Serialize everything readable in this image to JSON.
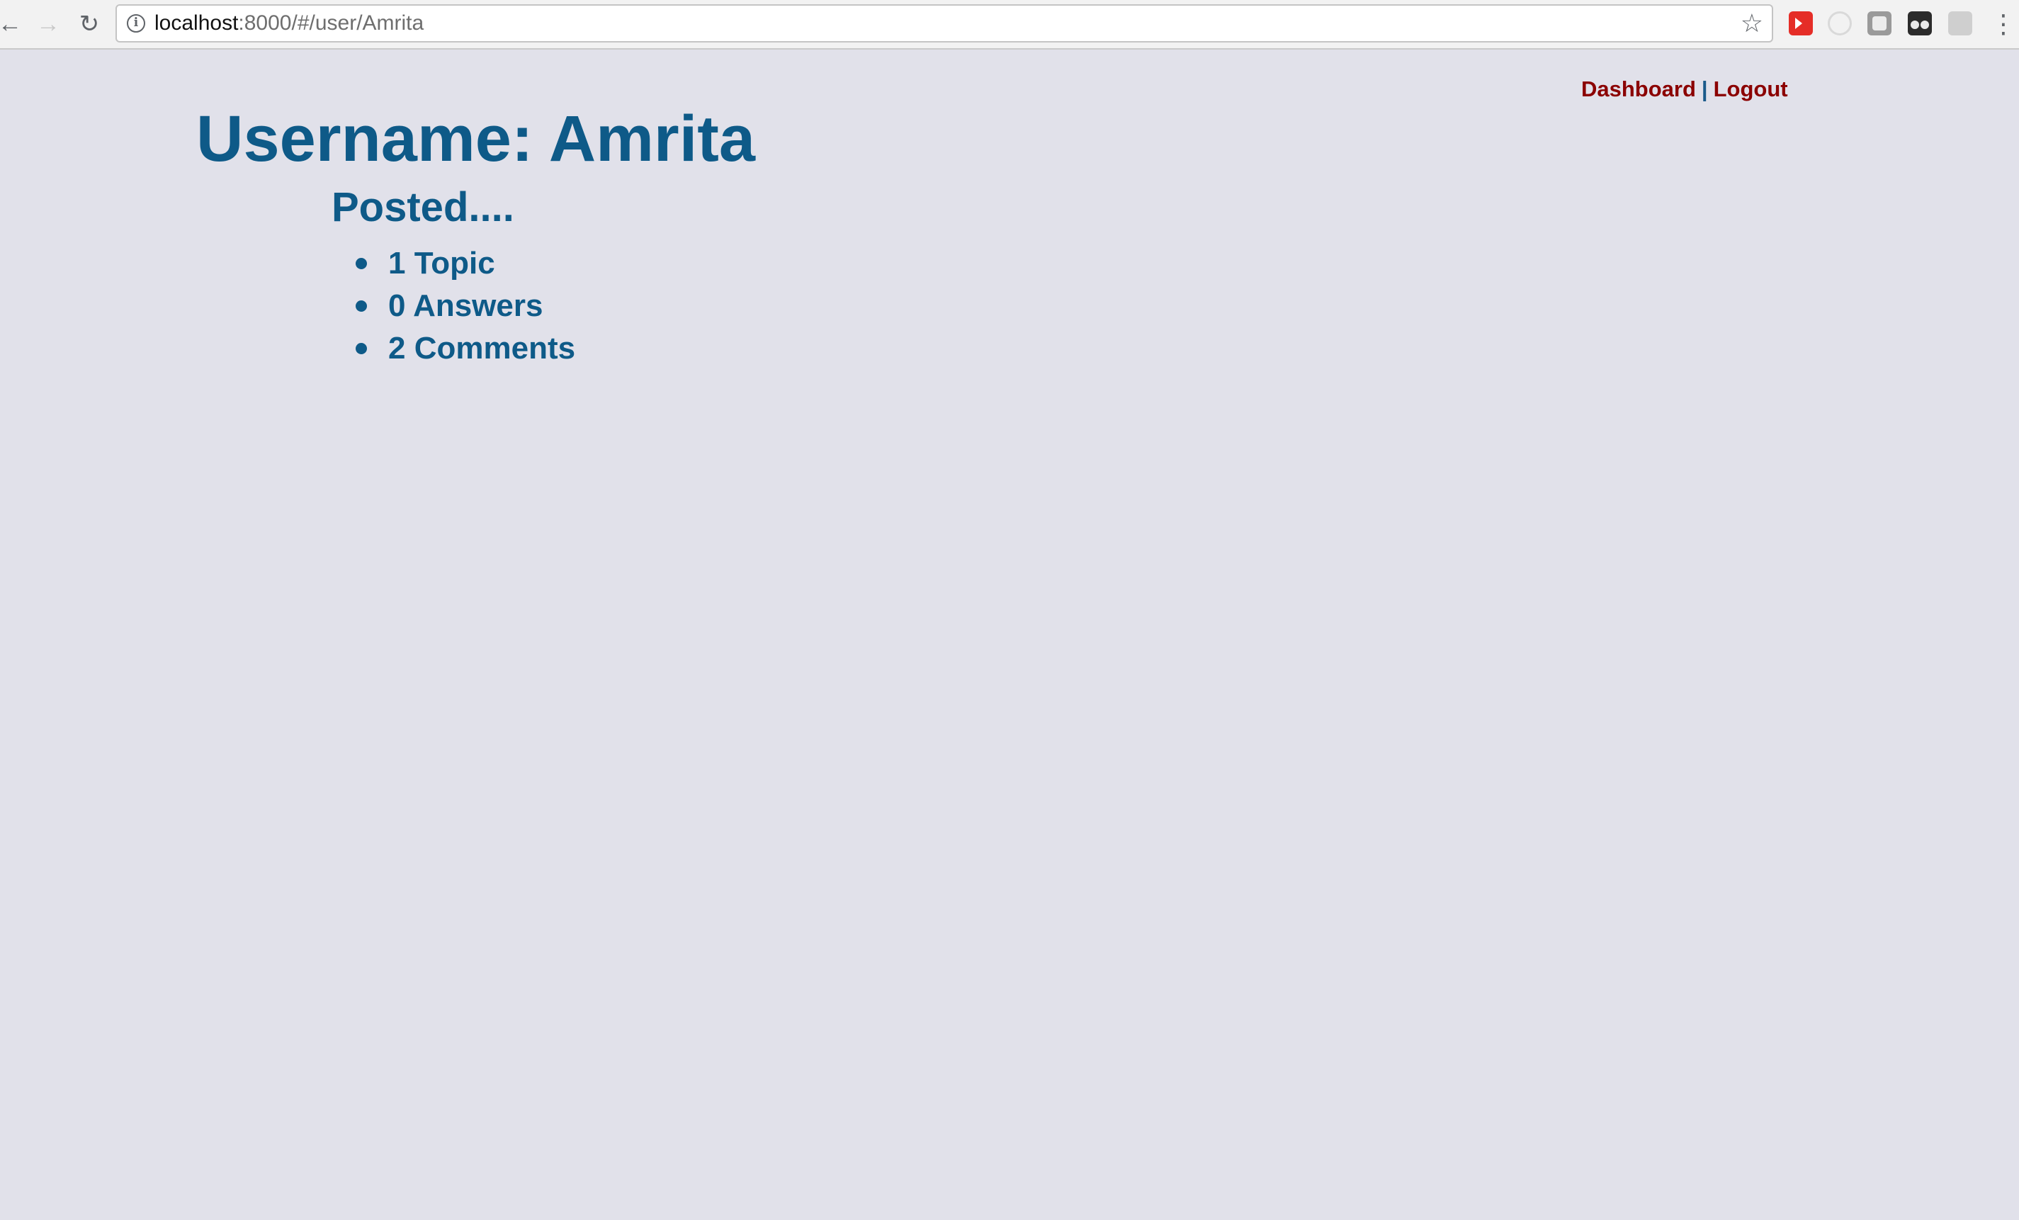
{
  "browser": {
    "url_host": "localhost",
    "url_path": ":8000/#/user/Amrita",
    "back_icon": "arrow-left-icon",
    "forward_icon": "arrow-right-icon",
    "reload_icon": "reload-icon",
    "info_glyph": "i",
    "star_icon": "star-icon",
    "extensions": [
      "youtube-extension-icon",
      "ghost-extension-icon",
      "box-extension-icon",
      "glasses-extension-icon",
      "copies-extension-icon"
    ],
    "menu_icon": "kebab-menu-icon"
  },
  "topnav": {
    "dashboard_label": "Dashboard",
    "separator": "|",
    "logout_label": "Logout"
  },
  "user": {
    "title": "Username: Amrita",
    "posted_heading": "Posted....",
    "counts": [
      {
        "label": "1 Topic"
      },
      {
        "label": "0 Answers"
      },
      {
        "label": "2 Comments"
      }
    ]
  },
  "colors": {
    "background": "#e1e1ea",
    "heading": "#0e5a88",
    "nav_link": "#8b0000"
  }
}
